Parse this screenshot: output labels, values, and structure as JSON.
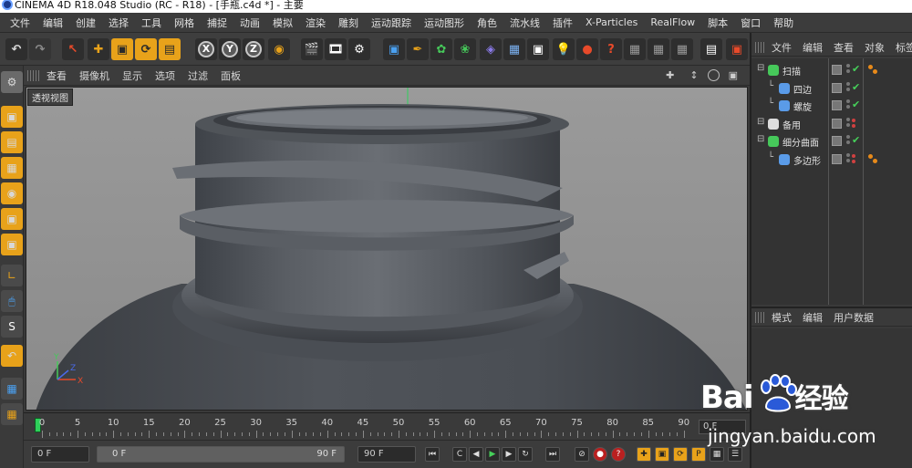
{
  "window": {
    "title": "CINEMA 4D R18.048 Studio (RC - R18) - [手瓶.c4d *] - 主要"
  },
  "menu": [
    "文件",
    "编辑",
    "创建",
    "选择",
    "工具",
    "网格",
    "捕捉",
    "动画",
    "模拟",
    "渲染",
    "雕刻",
    "运动跟踪",
    "运动图形",
    "角色",
    "流水线",
    "插件",
    "X-Particles",
    "RealFlow",
    "脚本",
    "窗口",
    "帮助"
  ],
  "toolbar": {
    "axis_x": "X",
    "axis_y": "Y",
    "axis_z": "Z"
  },
  "viewport": {
    "menu": [
      "查看",
      "摄像机",
      "显示",
      "选项",
      "过滤",
      "面板"
    ],
    "label": "透视视图",
    "axis_y": "Y",
    "axis_x": "X",
    "axis_z": "Z"
  },
  "timeline": {
    "ticks": [
      "0",
      "5",
      "10",
      "15",
      "20",
      "25",
      "30",
      "35",
      "40",
      "45",
      "50",
      "55",
      "60",
      "65",
      "70",
      "75",
      "80",
      "85",
      "90"
    ],
    "current_frame_display": "0 F"
  },
  "transport": {
    "current_frame": "0 F",
    "range_start": "0 F",
    "range_end": "90 F",
    "max_frame": "90 F"
  },
  "object_manager": {
    "tabs": [
      "文件",
      "编辑",
      "查看",
      "对象",
      "标签"
    ],
    "objects": [
      {
        "name": "扫描",
        "indent": 0,
        "icon_color": "#46c85a",
        "check": true,
        "tag": true
      },
      {
        "name": "四边",
        "indent": 1,
        "icon_color": "#5a9be8",
        "check": true,
        "tag": false
      },
      {
        "name": "螺旋",
        "indent": 1,
        "icon_color": "#5a9be8",
        "check": true,
        "tag": false
      },
      {
        "name": "备用",
        "indent": 0,
        "icon_color": "#dddddd",
        "check": false,
        "tag": false
      },
      {
        "name": "细分曲面",
        "indent": 0,
        "icon_color": "#46c85a",
        "check": true,
        "tag": false
      },
      {
        "name": "多边形",
        "indent": 1,
        "icon_color": "#5a9be8",
        "check": false,
        "tag": true
      }
    ]
  },
  "attribute_manager": {
    "tabs": [
      "模式",
      "编辑",
      "用户数据"
    ]
  },
  "watermark": {
    "logo_text": "Bai",
    "logo_suffix": "经验",
    "url": "jingyan.baidu.com"
  }
}
